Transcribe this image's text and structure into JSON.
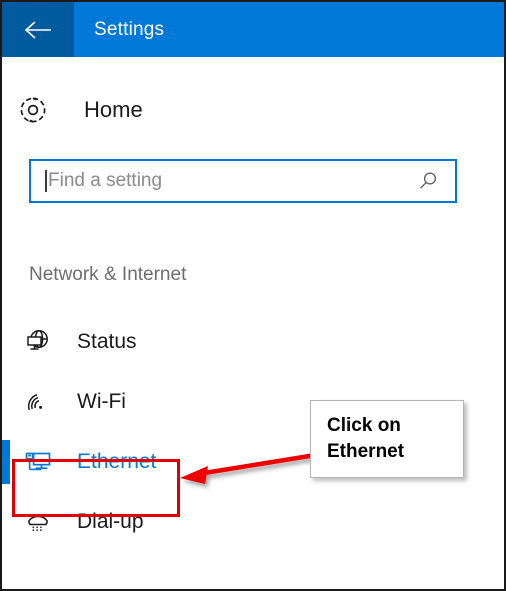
{
  "window": {
    "title": "Settings",
    "back_icon": "back-arrow-icon",
    "titlebar_color": "#0078d7",
    "back_button_color": "#005a9e"
  },
  "home": {
    "label": "Home",
    "icon": "gear-icon"
  },
  "search": {
    "value": "",
    "placeholder": "Find a setting",
    "icon": "search-icon",
    "border_color": "#0078d7"
  },
  "section": {
    "header": "Network & Internet"
  },
  "nav": {
    "items": [
      {
        "label": "Status",
        "icon": "globe-icon",
        "selected": false
      },
      {
        "label": "Wi-Fi",
        "icon": "wifi-icon",
        "selected": false
      },
      {
        "label": "Ethernet",
        "icon": "ethernet-icon",
        "selected": true
      },
      {
        "label": "Dial-up",
        "icon": "phone-icon",
        "selected": false
      }
    ],
    "selected_color": "#0b78d4"
  },
  "annotations": {
    "highlight_color": "#e00000",
    "callout": {
      "line1": "Click on",
      "line2": "Ethernet"
    },
    "arrow": "red-arrow-icon"
  }
}
